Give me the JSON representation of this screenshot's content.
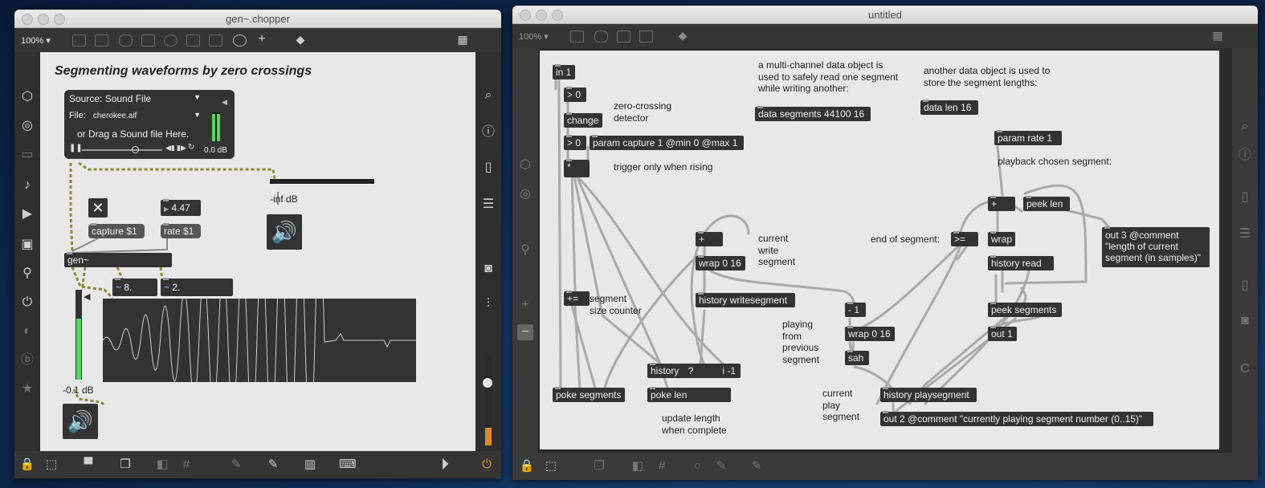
{
  "left_window": {
    "title": "gen~.chopper",
    "zoom": "100% ▾",
    "patch_title": "Segmenting waveforms by zero crossings",
    "source_menu": "Source: Sound File",
    "file_label": "File:",
    "file_name": "cherokee.aif",
    "drag_hint": "or Drag a Sound file Here.",
    "player_level": "0.0 dB",
    "number_box": "4.47",
    "capture_msg": "capture $1",
    "rate_msg": "rate $1",
    "gen_obj": "gen~",
    "sig1": "8.",
    "sig2": "2.",
    "right_meter": "-inf dB",
    "out_level": "-0.1 dB"
  },
  "right_window": {
    "title": "untitled",
    "zoom": "100% ▾",
    "objects": {
      "in1": "in 1",
      "gt0a": "> 0",
      "change": "change",
      "gt0b": "> 0",
      "param_capture": "param capture 1 @min 0 @max 1",
      "mult": "*",
      "data_segments": "data segments 44100 16",
      "data_len": "data len 16",
      "param_rate": "param rate 1",
      "plus1": "+",
      "wrap016a": "wrap 0 16",
      "history_ws": "history writesegment",
      "pluseq": "+=",
      "history_q": "history",
      "history_q_q": "?",
      "history_q_i": "i -1",
      "poke_segments": "poke segments",
      "poke_len": "poke len",
      "minus1": "- 1",
      "wrap016b": "wrap 0 16",
      "sah": "sah",
      "history_ps": "history playsegment",
      "out2": "out 2 @comment \"currently playing segment number (0..15)\"",
      "plus2": "+",
      "peek_len": "peek len",
      "gte": ">=",
      "wrap": "wrap",
      "history_read": "history read",
      "peek_segments": "peek segments",
      "out1": "out 1",
      "out3": "out 3 @comment\n\"length of current\nsegment (in samples)\""
    },
    "comments": {
      "zero_cross": "zero-crossing\ndetector",
      "trigger": "trigger only when rising",
      "multi_channel": "a multi-channel data object is\nused to safely read one segment\nwhile writing another:",
      "another": "another data object is used to\nstore the segment lengths:",
      "playback": "playback chosen segment:",
      "current_write": "current\nwrite\nsegment",
      "end_seg": "end of segment:",
      "seg_size": "segment\nsize counter",
      "playing_from": "playing\nfrom\nprevious\nsegment",
      "current_play": "current\nplay\nsegment",
      "update_len": "update length\nwhen complete"
    }
  }
}
